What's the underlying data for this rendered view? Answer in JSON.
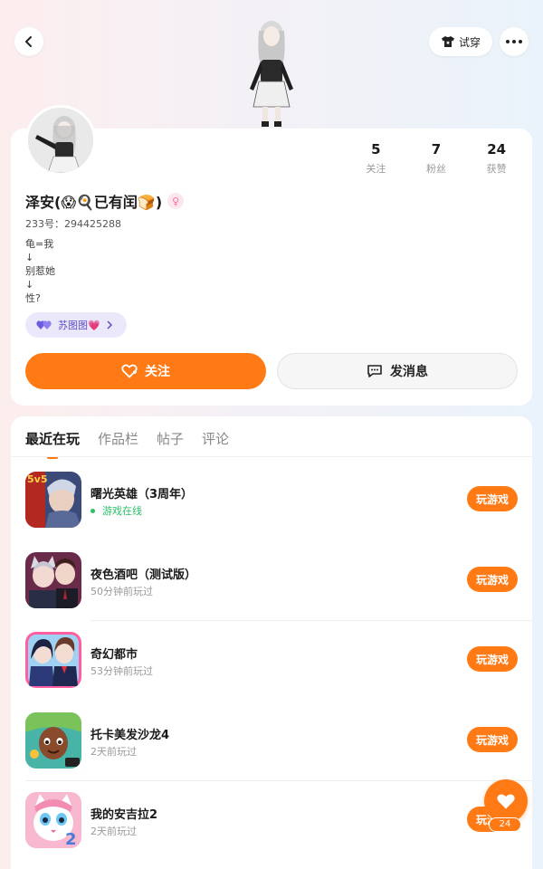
{
  "header": {
    "try_on_label": "试穿"
  },
  "profile": {
    "stats": [
      {
        "value": "5",
        "label": "关注"
      },
      {
        "value": "7",
        "label": "粉丝"
      },
      {
        "value": "24",
        "label": "获赞"
      }
    ],
    "name": "泽安(😱🍳已有闰🍞)",
    "gender_symbol": "♀",
    "uid": "233号：294425288",
    "bio_lines": [
      "龟=我",
      "↓",
      "别惹她",
      "↓",
      "性?"
    ],
    "tag_label": "苏图图💗",
    "follow_label": "关注",
    "message_label": "发消息"
  },
  "tabs": [
    {
      "label": "最近在玩",
      "active": true
    },
    {
      "label": "作品栏",
      "active": false
    },
    {
      "label": "帖子",
      "active": false
    },
    {
      "label": "评论",
      "active": false
    }
  ],
  "games": [
    {
      "title": "曙光英雄（3周年）",
      "status": "游戏在线",
      "online": true,
      "play_label": "玩游戏"
    },
    {
      "title": "夜色酒吧（测试版）",
      "status": "50分钟前玩过",
      "online": false,
      "play_label": "玩游戏"
    },
    {
      "title": "奇幻都市",
      "status": "53分钟前玩过",
      "online": false,
      "play_label": "玩游戏"
    },
    {
      "title": "托卡美发沙龙4",
      "status": "2天前玩过",
      "online": false,
      "play_label": "玩游戏"
    },
    {
      "title": "我的安吉拉2",
      "status": "2天前玩过",
      "online": false,
      "play_label": "玩游戏"
    }
  ],
  "game_icon_text": {
    "hero_badge": "5v5",
    "angela_badge": "2"
  },
  "like": {
    "count": "24"
  },
  "colors": {
    "accent": "#ff7a15",
    "online": "#2bbf6a",
    "tag_bg": "#ece8fb"
  }
}
